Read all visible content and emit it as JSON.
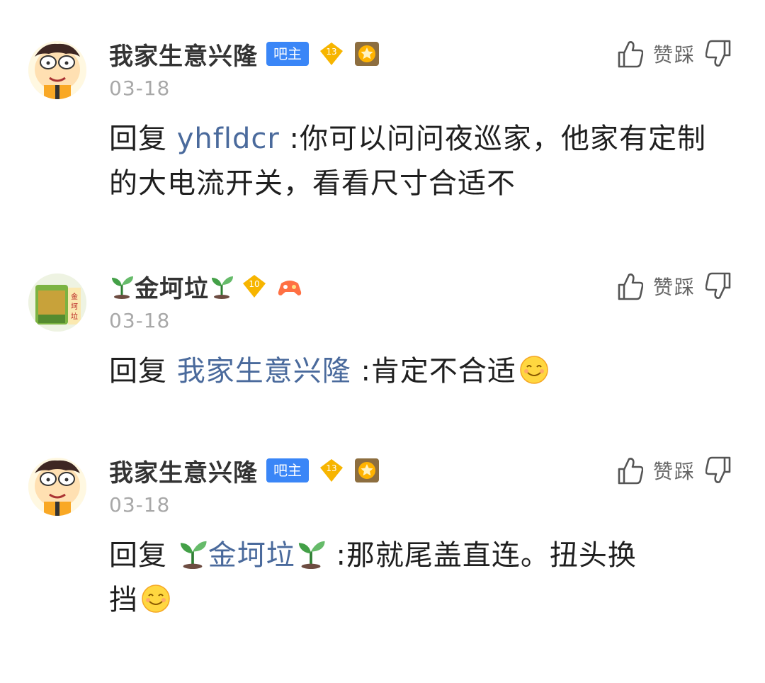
{
  "actions": {
    "dislike_label": "赞踩"
  },
  "comments": [
    {
      "username": "我家生意兴隆",
      "admin_badge": "吧主",
      "level": "13",
      "date": "03-18",
      "reply_prefix": "回复",
      "reply_to": "yhfldcr",
      "content": ":你可以问问夜巡家，他家有定制的大电流开关，看看尺寸合适不"
    },
    {
      "username": "金坷垃",
      "level": "10",
      "date": "03-18",
      "reply_prefix": "回复",
      "reply_to": "我家生意兴隆",
      "content": ":肯定不合适"
    },
    {
      "username": "我家生意兴隆",
      "admin_badge": "吧主",
      "level": "13",
      "date": "03-18",
      "reply_prefix": "回复",
      "reply_to": "金坷垃",
      "content_line1": ":那就尾盖直连。扭头换",
      "content_line2": "挡"
    }
  ],
  "colors": {
    "admin_badge": "#3a86f7",
    "reply_link": "#4a6a9c",
    "date": "#a8a8a8",
    "level_badge": "#f7b500"
  }
}
